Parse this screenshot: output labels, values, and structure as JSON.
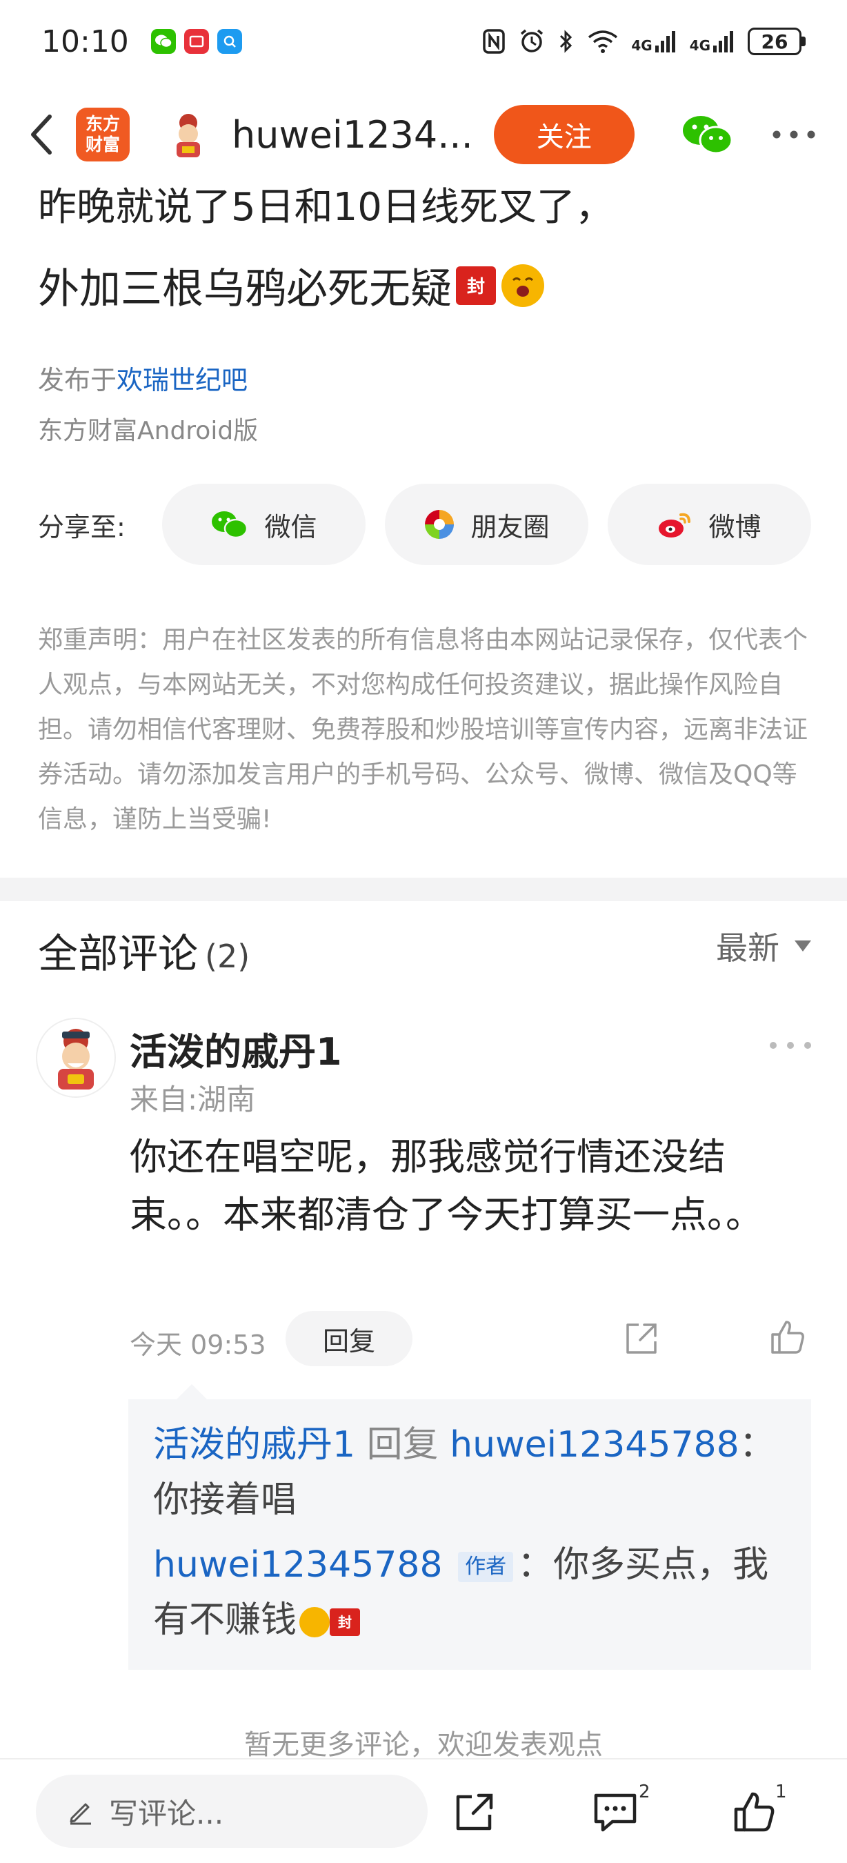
{
  "status_bar": {
    "time": "10:10",
    "network_1": "4G",
    "network_2": "4G",
    "battery": "26"
  },
  "nav": {
    "app_logo_line1": "东方",
    "app_logo_line2": "财富",
    "username": "huwei1234...",
    "follow_label": "关注"
  },
  "article": {
    "title_line1": "昨晚就说了5日和10日线死叉了，",
    "title_line2": "外加三根乌鸦必死无疑",
    "emoji_feng": "封",
    "publish_prefix": "发布于",
    "publish_bar": "欢瑞世纪吧",
    "client": "东方财富Android版"
  },
  "share": {
    "label": "分享至:",
    "wechat": "微信",
    "moments": "朋友圈",
    "weibo": "微博"
  },
  "disclaimer": "郑重声明：用户在社区发表的所有信息将由本网站记录保存，仅代表个人观点，与本网站无关，不对您构成任何投资建议，据此操作风险自担。请勿相信代客理财、免费荐股和炒股培训等宣传内容，远离非法证券活动。请勿添加发言用户的手机号码、公众号、微博、微信及QQ等信息，谨防上当受骗!",
  "comments": {
    "title": "全部评论",
    "count": "(2)",
    "sort": "最新",
    "items": [
      {
        "username": "活泼的戚丹1",
        "location": "来自:湖南",
        "body": "你还在唱空呢，那我感觉行情还没结束。。本来都清仓了今天打算买一点。。",
        "time": "今天 09:53",
        "reply_label": "回复",
        "replies": [
          {
            "from": "活泼的戚丹1",
            "action": "回复",
            "to": "huwei12345788",
            "sep": "：",
            "text": "你接着唱"
          },
          {
            "from": "huwei12345788",
            "tag": "作者",
            "sep": "：",
            "text": "你多买点，我有不赚钱",
            "emoji_feng": "封"
          }
        ]
      }
    ],
    "no_more": "暂无更多评论，欢迎发表观点"
  },
  "bottom_bar": {
    "input_placeholder": "写评论...",
    "comment_count": "2",
    "like_count": "1"
  },
  "colors": {
    "accent": "#f0561a",
    "link": "#1a65c3",
    "logo": "#f05a22"
  }
}
